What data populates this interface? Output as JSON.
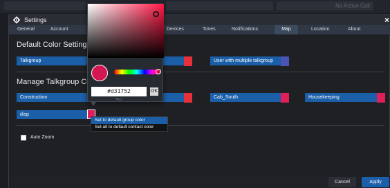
{
  "topbar": {
    "status_text": "No Active Call"
  },
  "dialog": {
    "title": "Settings",
    "close_label": "×",
    "tabs": [
      "General",
      "Account",
      "Devices",
      "Tones",
      "Notifications",
      "Map",
      "Location",
      "About"
    ],
    "active_tab": "Map"
  },
  "default_colors": {
    "heading": "Default Color Settings",
    "items": [
      {
        "label": "Talkgroup",
        "color": "#e8303a"
      },
      {
        "label": "User with multiple talkgroup",
        "color": "#4b53b5"
      }
    ]
  },
  "manage_colors": {
    "heading": "Manage Talkgroup Colors",
    "items": [
      {
        "label": "Construction",
        "color": "#e8303a"
      },
      {
        "label": "Cab_South",
        "color": "#e01e5a"
      },
      {
        "label": "Housekeeping",
        "color": "#e01e5a"
      },
      {
        "label": "disp",
        "color": "#e01e5a"
      }
    ]
  },
  "options": {
    "auto_zoom_label": "Auto Zoom",
    "auto_zoom_checked": false
  },
  "buttons": {
    "cancel": "Cancel",
    "apply": "Apply"
  },
  "color_picker": {
    "hex_value": "#d31752",
    "ok_label": "OK",
    "hex_caption": "Hex",
    "selected_color": "#d31752"
  },
  "context_menu": {
    "items": [
      "Set to default group color",
      "Set all to default contact color"
    ],
    "highlighted_index": 0
  }
}
